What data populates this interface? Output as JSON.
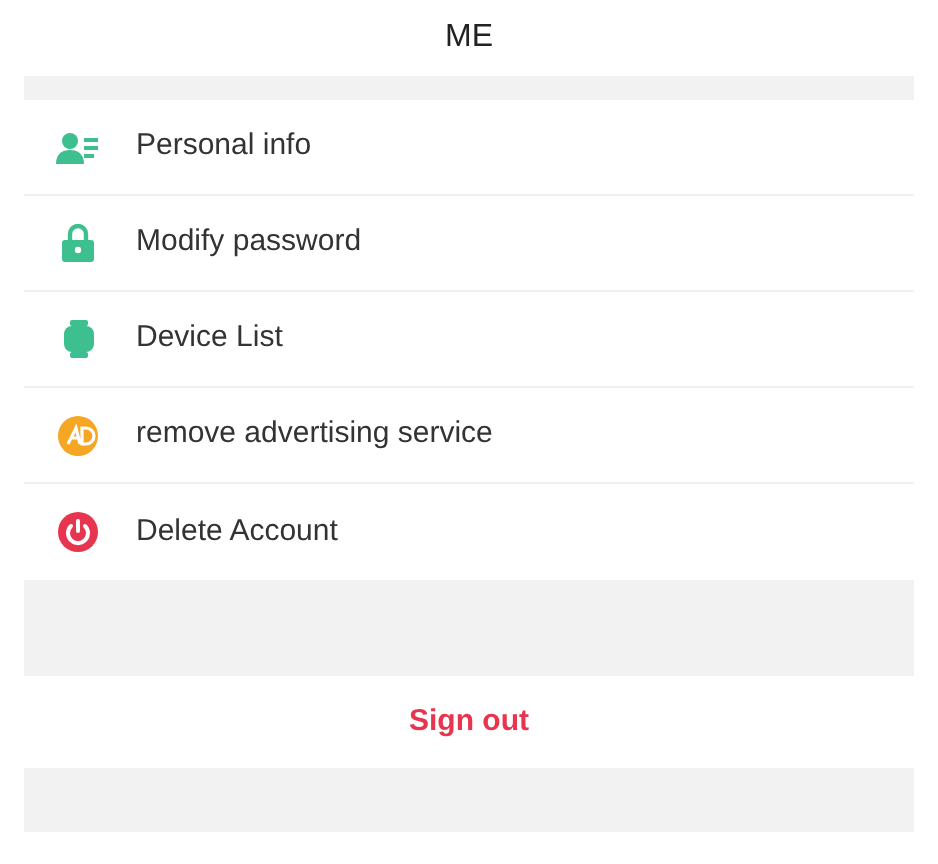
{
  "header": {
    "title": "ME"
  },
  "menu": [
    {
      "kind": "profile",
      "label": "Personal info"
    },
    {
      "kind": "lock",
      "label": "Modify password"
    },
    {
      "kind": "watch",
      "label": "Device List"
    },
    {
      "kind": "ad",
      "label": "remove advertising service"
    },
    {
      "kind": "power",
      "label": "Delete Account"
    }
  ],
  "sign_out": {
    "label": "Sign out"
  }
}
